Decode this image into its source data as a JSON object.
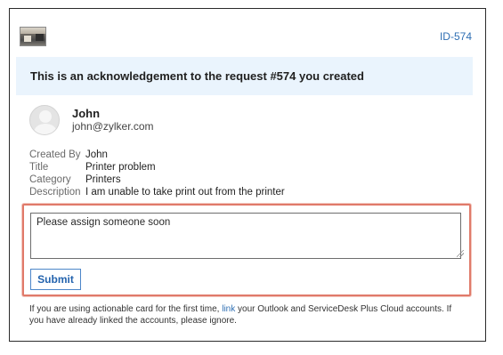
{
  "header": {
    "logo_icon": "building-photo-logo",
    "ticket_id": "ID-574"
  },
  "banner": {
    "text": "This is an acknowledgement to the request #574 you created"
  },
  "requester": {
    "avatar_icon": "default-user-avatar",
    "name": "John",
    "email": "john@zylker.com"
  },
  "details": [
    {
      "label": "Created By",
      "value": "John"
    },
    {
      "label": "Title",
      "value": "Printer problem"
    },
    {
      "label": "Category",
      "value": "Printers"
    },
    {
      "label": "Description",
      "value": "I am unable to take print out from the printer"
    }
  ],
  "form": {
    "comment_value": "Please assign someone soon",
    "submit_label": "Submit",
    "highlight_color": "#e07a6a"
  },
  "footnote": {
    "before_link": "If you are using actionable card for the first time, ",
    "link_text": "link",
    "after_link": " your Outlook and ServiceDesk Plus Cloud accounts. If you have already linked the accounts, please ignore."
  },
  "colors": {
    "accent": "#2f6fb3",
    "banner_bg": "#eaf4fd"
  }
}
